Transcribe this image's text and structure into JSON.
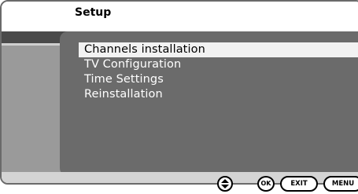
{
  "header": {
    "title": "Setup"
  },
  "menu": {
    "items": [
      {
        "label": "Channels installation",
        "selected": true
      },
      {
        "label": "TV Configuration",
        "selected": false
      },
      {
        "label": "Time Settings",
        "selected": false
      },
      {
        "label": "Reinstallation",
        "selected": false
      }
    ]
  },
  "footer": {
    "nav_icon": "up-down-arrows-icon",
    "ok_label": "OK",
    "exit_label": "EXIT",
    "menu_label": "MENU"
  },
  "colors": {
    "panel": "#6b6b6b",
    "band": "#4a4a4a",
    "highlight": "#f2f2f2"
  }
}
